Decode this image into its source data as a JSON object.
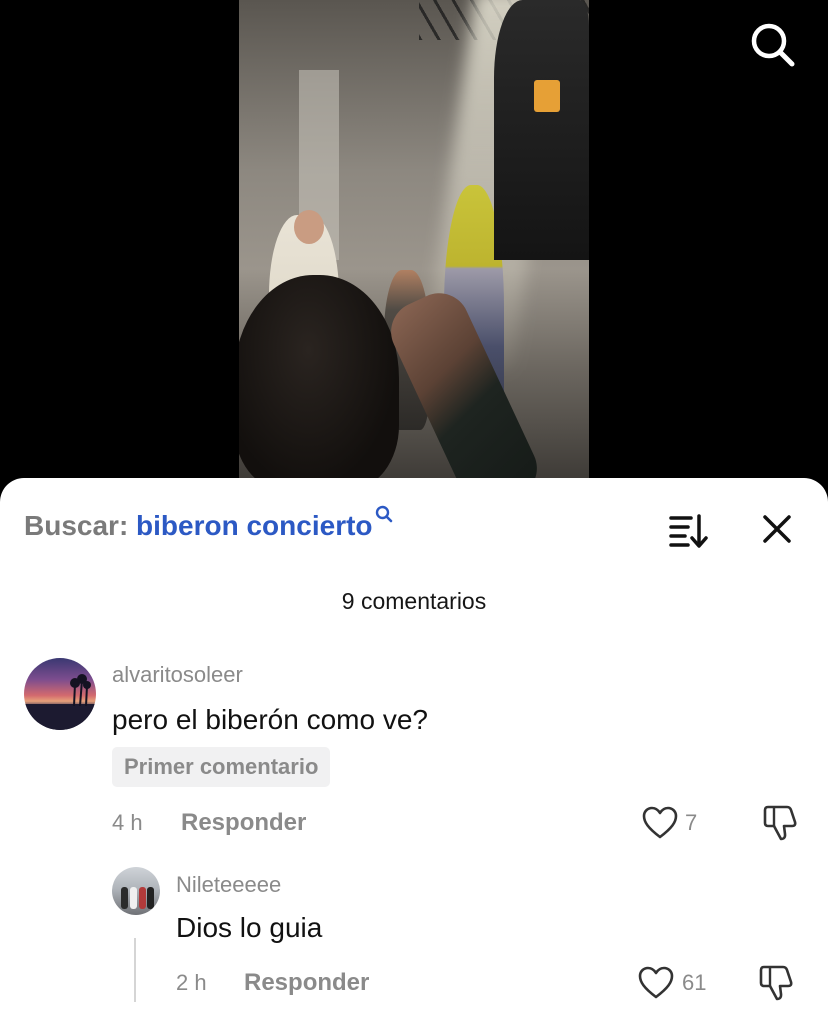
{
  "video": {
    "search_icon": "search-icon"
  },
  "comments_panel": {
    "search_label": "Buscar:",
    "search_term": "biberon concierto",
    "sort_icon": "sort-icon",
    "close_icon": "close-icon",
    "count_label": "9 comentarios",
    "comments": [
      {
        "username": "alvaritosoleer",
        "text": "pero el biberón como ve?",
        "badge": "Primer comentario",
        "time": "4 h",
        "reply_label": "Responder",
        "likes": "7"
      }
    ],
    "replies": [
      {
        "username": "Nileteeeee",
        "text": "Dios lo guia",
        "time": "2 h",
        "reply_label": "Responder",
        "likes": "61"
      }
    ]
  },
  "colors": {
    "accent_blue": "#2c59c4",
    "muted_gray": "#8a8a8a",
    "sheet_bg": "#ffffff"
  }
}
